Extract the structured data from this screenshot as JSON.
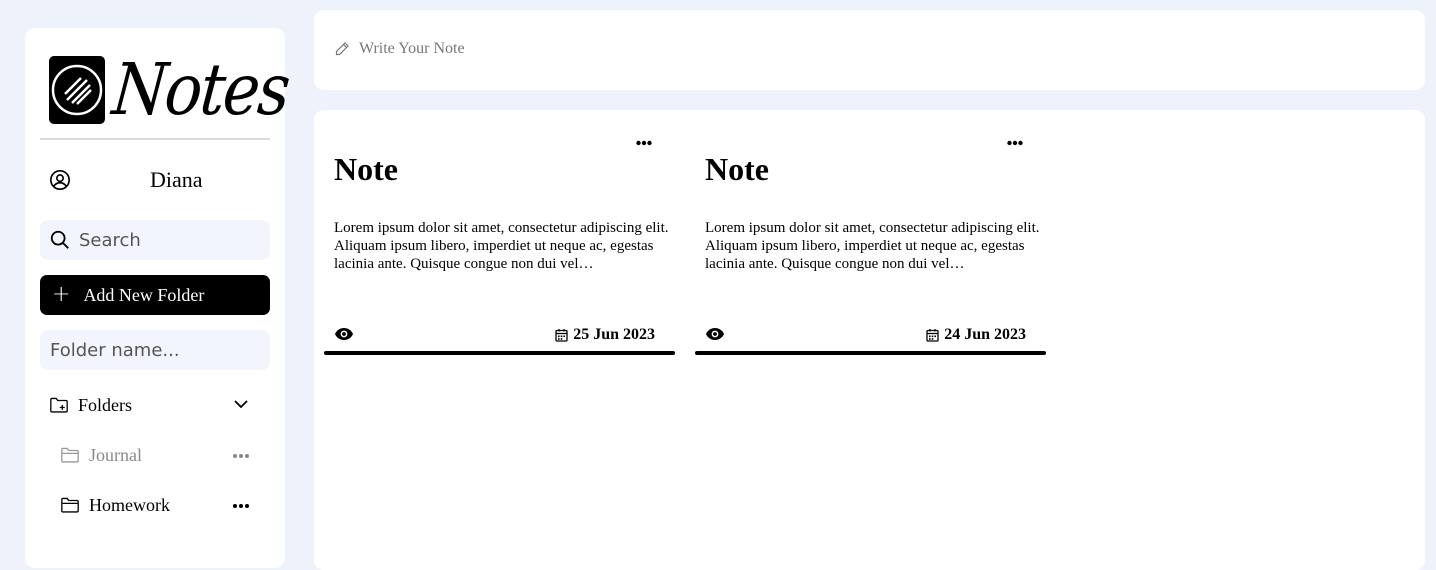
{
  "app": {
    "logo_text": "Notes"
  },
  "user": {
    "name": "Diana"
  },
  "sidebar": {
    "search_placeholder": "Search",
    "add_folder_label": "Add New Folder",
    "folder_name_placeholder": "Folder name...",
    "folders_label": "Folders",
    "folders": [
      {
        "label": "Journal",
        "state": "muted"
      },
      {
        "label": "Homework",
        "state": "normal"
      }
    ]
  },
  "topbar": {
    "write_note_placeholder": "Write Your Note"
  },
  "notes": [
    {
      "title": "Note",
      "body": "Lorem ipsum dolor sit amet, consectetur adipiscing elit. Aliquam ipsum libero, imperdiet ut neque ac, egestas lacinia ante. Quisque congue non dui vel…",
      "date": "25 Jun 2023"
    },
    {
      "title": "Note",
      "body": "Lorem ipsum dolor sit amet, consectetur adipiscing elit. Aliquam ipsum libero, imperdiet ut neque ac, egestas lacinia ante. Quisque congue non dui vel…",
      "date": "24 Jun 2023"
    }
  ],
  "icons": {
    "logo": "logo-mark-icon",
    "user": "user-circle-icon",
    "search": "search-icon",
    "add": "plus-icon",
    "folders": "folder-plus-icon",
    "chevron": "chevron-down-icon",
    "folder": "folder-icon",
    "more": "more-horizontal-icon",
    "write": "pencil-icon",
    "view": "eye-icon",
    "calendar": "calendar-icon"
  },
  "colors": {
    "background": "#eef2fa",
    "panel": "#ffffff",
    "input_bg": "#f2f5fd",
    "accent": "#000000",
    "muted_text": "#8a8a8a"
  }
}
